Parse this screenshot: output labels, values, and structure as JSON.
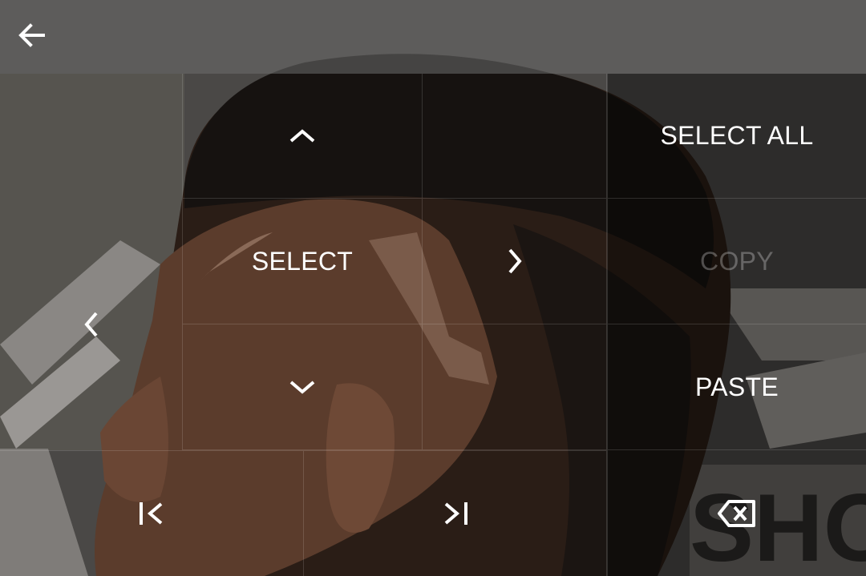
{
  "topbar": {
    "back_icon": "arrow-left-icon"
  },
  "dpad": {
    "up_icon": "chevron-up-icon",
    "down_icon": "chevron-down-icon",
    "left_icon": "chevron-left-icon",
    "right_icon": "chevron-right-icon",
    "select_label": "SELECT",
    "line_start_icon": "line-start-icon",
    "line_end_icon": "line-end-icon"
  },
  "actions": {
    "select_all_label": "SELECT ALL",
    "copy_label": "COPY",
    "copy_enabled": false,
    "paste_label": "PASTE",
    "backspace_icon": "backspace-icon"
  },
  "colors": {
    "text": "#ffffff",
    "disabled_text": "#6e6e6e"
  }
}
